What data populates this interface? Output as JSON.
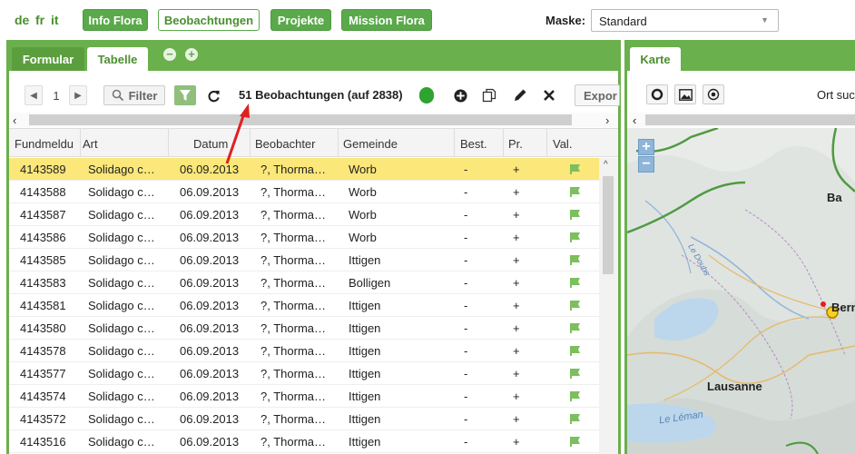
{
  "languages": [
    "de",
    "fr",
    "it"
  ],
  "nav": {
    "info_flora": "Info Flora",
    "beobachtungen": "Beobachtungen",
    "projekte": "Projekte",
    "mission_flora": "Mission Flora"
  },
  "maske": {
    "label": "Maske:",
    "value": "Standard"
  },
  "left_tabs": {
    "formular": "Formular",
    "tabelle": "Tabelle"
  },
  "toolbar": {
    "page": "1",
    "filter_label": "Filter",
    "count_text": "51 Beobachtungen (auf 2838)",
    "export_label": "Expor"
  },
  "table": {
    "headers": [
      "Fundmeldu",
      "Art",
      "Datum",
      "Beobachter",
      "Gemeinde",
      "Best.",
      "Pr.",
      "Val."
    ],
    "rows": [
      [
        "4143589",
        "Solidago c…",
        "06.09.2013",
        "?, Thorma…",
        "Worb",
        "-",
        "+"
      ],
      [
        "4143588",
        "Solidago c…",
        "06.09.2013",
        "?, Thorma…",
        "Worb",
        "-",
        "+"
      ],
      [
        "4143587",
        "Solidago c…",
        "06.09.2013",
        "?, Thorma…",
        "Worb",
        "-",
        "+"
      ],
      [
        "4143586",
        "Solidago c…",
        "06.09.2013",
        "?, Thorma…",
        "Worb",
        "-",
        "+"
      ],
      [
        "4143585",
        "Solidago c…",
        "06.09.2013",
        "?, Thorma…",
        "Ittigen",
        "-",
        "+"
      ],
      [
        "4143583",
        "Solidago c…",
        "06.09.2013",
        "?, Thorma…",
        "Bolligen",
        "-",
        "+"
      ],
      [
        "4143581",
        "Solidago c…",
        "06.09.2013",
        "?, Thorma…",
        "Ittigen",
        "-",
        "+"
      ],
      [
        "4143580",
        "Solidago c…",
        "06.09.2013",
        "?, Thorma…",
        "Ittigen",
        "-",
        "+"
      ],
      [
        "4143578",
        "Solidago c…",
        "06.09.2013",
        "?, Thorma…",
        "Ittigen",
        "-",
        "+"
      ],
      [
        "4143577",
        "Solidago c…",
        "06.09.2013",
        "?, Thorma…",
        "Ittigen",
        "-",
        "+"
      ],
      [
        "4143574",
        "Solidago c…",
        "06.09.2013",
        "?, Thorma…",
        "Ittigen",
        "-",
        "+"
      ],
      [
        "4143572",
        "Solidago c…",
        "06.09.2013",
        "?, Thorma…",
        "Ittigen",
        "-",
        "+"
      ],
      [
        "4143516",
        "Solidago c…",
        "06.09.2013",
        "?, Thorma…",
        "Ittigen",
        "-",
        "+"
      ]
    ]
  },
  "map": {
    "tab": "Karte",
    "search_label": "Ort such",
    "labels": {
      "bern": "Bern",
      "lausanne": "Lausanne",
      "leman": "Le Léman",
      "ba": "Ba",
      "le_doubs": "Le Doubs"
    }
  },
  "colors": {
    "accent": "#6ab04c",
    "selected_row": "#fbe77a",
    "annotation_arrow": "#e02020"
  }
}
